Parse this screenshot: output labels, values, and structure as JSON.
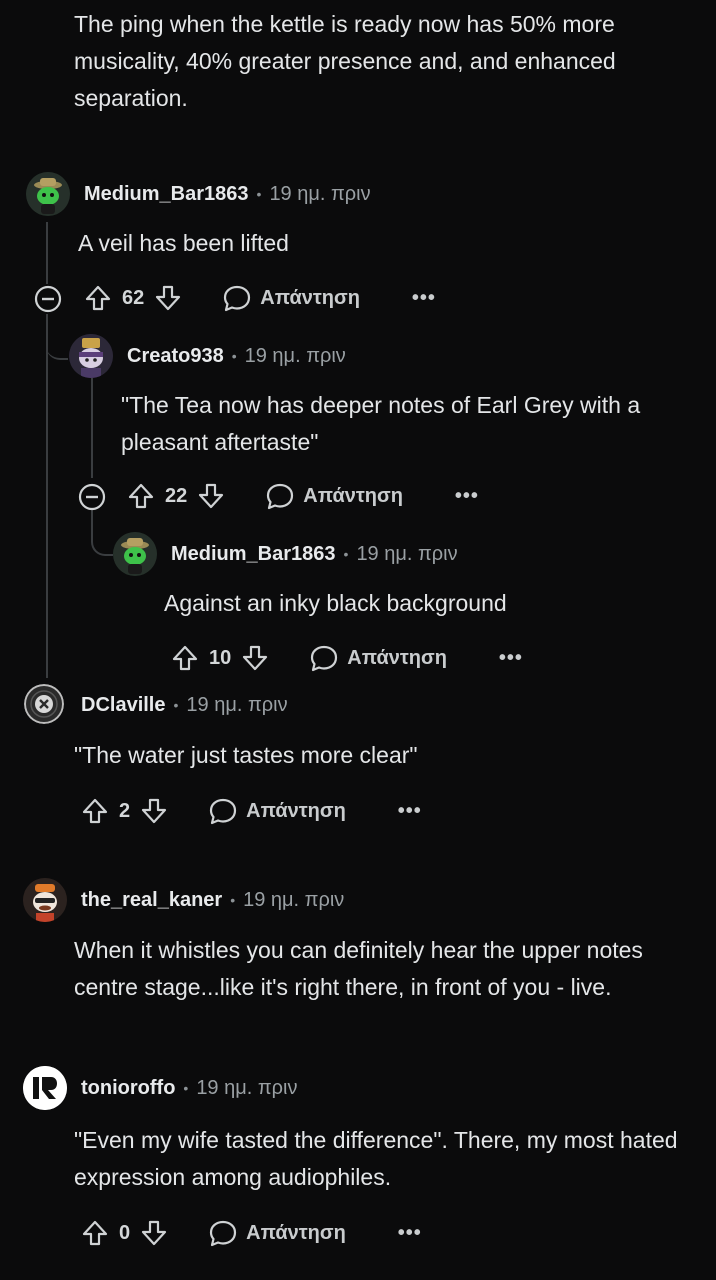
{
  "comments": [
    {
      "user": "",
      "time": "",
      "text": "The ping when the kettle is ready now has 50% more musicality, 40% greater presence and, and enhanced separation."
    },
    {
      "user": "Medium_Bar1863",
      "time": "19 ημ. πριν",
      "text": "A veil has been lifted",
      "votes": "62",
      "reply": "Απάντηση"
    },
    {
      "user": "Creato938",
      "time": "19 ημ. πριν",
      "text": "\"The Tea now has deeper notes of Earl Grey with a pleasant aftertaste\"",
      "votes": "22",
      "reply": "Απάντηση"
    },
    {
      "user": "Medium_Bar1863",
      "time": "19 ημ. πριν",
      "text": "Against an inky black background",
      "votes": "10",
      "reply": "Απάντηση"
    },
    {
      "user": "DClaville",
      "time": "19 ημ. πριν",
      "text": "\"The water just tastes more clear\"",
      "votes": "2",
      "reply": "Απάντηση"
    },
    {
      "user": "the_real_kaner",
      "time": "19 ημ. πριν",
      "text": "When it whistles you can definitely hear the upper notes centre stage...like it's right there, in front of you - live."
    },
    {
      "user": "tonioroffo",
      "time": "19 ημ. πριν",
      "text": "\"Even my wife tasted the difference\". There, my most hated expression among audiophiles.",
      "votes": "0",
      "reply": "Απάντηση"
    }
  ],
  "icons": {
    "upvote": "arrow-up-icon",
    "downvote": "arrow-down-icon",
    "reply": "speech-bubble-icon",
    "collapse": "minus-circle-icon",
    "more": "more-dots-icon"
  },
  "colors": {
    "background": "#0b0b0c",
    "text": "#e4e6e8",
    "muted": "#9aa0a4",
    "thread_line": "#3a3d40"
  },
  "more_label": "•••"
}
